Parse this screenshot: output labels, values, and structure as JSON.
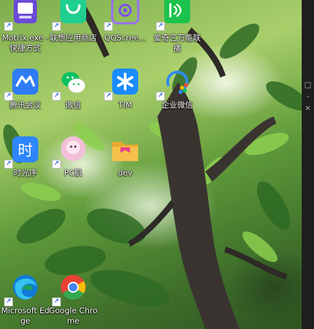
{
  "desktop": {
    "icons": [
      {
        "label": "Motrix.exe - 快捷方式",
        "icon": "motrix-icon",
        "color": "#6a4bd6"
      },
      {
        "label": "联想应用商店",
        "icon": "lenovo-store-icon",
        "color": "#1fcf8f"
      },
      {
        "label": "QQScree...",
        "icon": "qqscreenshot-icon",
        "color": "#7c4dff"
      },
      {
        "label": "爱奇艺万能联播",
        "icon": "iqiyi-icon",
        "color": "#1bc24b"
      },
      {
        "label": "腾讯会议",
        "icon": "tencent-meeting-icon",
        "color": "#2f7cf6"
      },
      {
        "label": "微信",
        "icon": "wechat-icon",
        "color": "#07c160"
      },
      {
        "label": "TIM",
        "icon": "tim-icon",
        "color": "#1a8cff"
      },
      {
        "label": "企业微信",
        "icon": "wecom-icon",
        "color": "#2d8cf0"
      },
      {
        "label": "时光序",
        "icon": "shiguangxu-icon",
        "color": "#2e86ff"
      },
      {
        "label": "PC肌",
        "icon": "pc-app-icon",
        "color": "#f2c0d8"
      },
      {
        "label": "dev",
        "icon": "folder-icon",
        "color": "#f4c04a"
      },
      {
        "label": "Microsoft Edge",
        "icon": "edge-icon",
        "color": "#0f7bd6"
      },
      {
        "label": "Google Chrome",
        "icon": "chrome-icon",
        "color": "#e94235"
      }
    ],
    "shortcut_arrow": "↗"
  },
  "right_edge": {
    "glyphs": [
      "□",
      "-",
      "×"
    ]
  }
}
